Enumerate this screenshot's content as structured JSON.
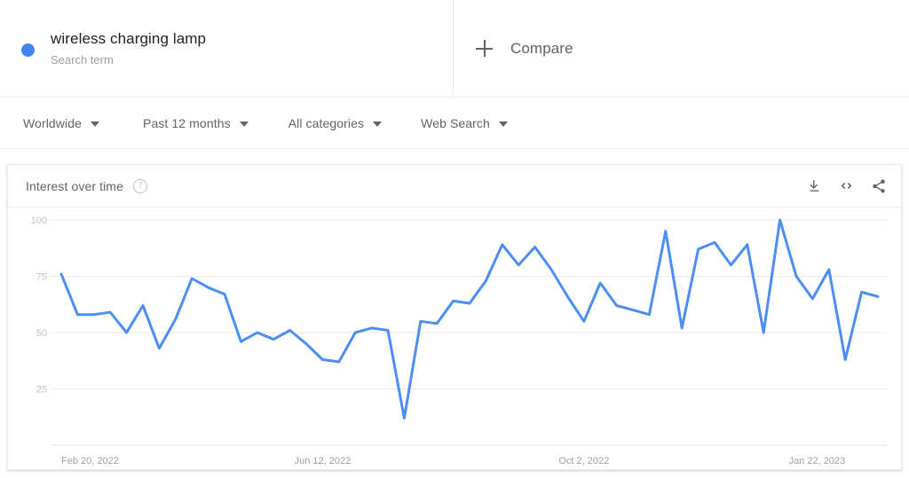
{
  "term": {
    "name": "wireless charging lamp",
    "type_label": "Search term",
    "dot_color": "#4285f4"
  },
  "compare": {
    "label": "Compare",
    "icon": "plus-icon"
  },
  "filters": [
    {
      "label": "Worldwide",
      "icon": "chevron-down-icon"
    },
    {
      "label": "Past 12 months",
      "icon": "chevron-down-icon"
    },
    {
      "label": "All categories",
      "icon": "chevron-down-icon"
    },
    {
      "label": "Web Search",
      "icon": "chevron-down-icon"
    }
  ],
  "card": {
    "title": "Interest over time",
    "help_icon": "help-circle-icon",
    "help_glyph": "?",
    "actions": [
      {
        "name": "download-icon"
      },
      {
        "name": "embed-code-icon"
      },
      {
        "name": "share-icon"
      }
    ]
  },
  "chart_data": {
    "type": "line",
    "title": "Interest over time",
    "xlabel": "",
    "ylabel": "",
    "ylim": [
      0,
      100
    ],
    "yticks": [
      25,
      50,
      75,
      100
    ],
    "grid": true,
    "legend": false,
    "line_color": "#4c8df6",
    "x_tick_labels": [
      "Feb 20, 2022",
      "Jun 12, 2022",
      "Oct 2, 2022",
      "Jan 22, 2023"
    ],
    "x_tick_indices": [
      0,
      16,
      32,
      48
    ],
    "series": [
      {
        "name": "wireless charging lamp",
        "values": [
          76,
          58,
          58,
          59,
          50,
          62,
          43,
          56,
          74,
          70,
          67,
          46,
          50,
          47,
          51,
          45,
          38,
          37,
          50,
          52,
          51,
          12,
          55,
          54,
          64,
          63,
          73,
          89,
          80,
          88,
          78,
          66,
          55,
          72,
          62,
          60,
          58,
          95,
          52,
          87,
          90,
          80,
          89,
          50,
          100,
          75,
          65,
          78,
          38,
          68,
          66
        ]
      }
    ]
  }
}
